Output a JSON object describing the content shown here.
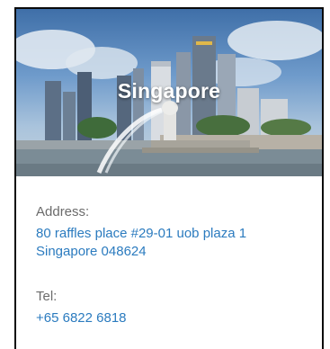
{
  "card": {
    "title": "Singapore",
    "address_label": "Address:",
    "address_line1": "80 raffles place #29-01 uob plaza 1",
    "address_line2": "Singapore 048624",
    "tel_label": "Tel:",
    "tel_value": "+65 6822 6818"
  },
  "colors": {
    "link": "#2b7bbf",
    "label": "#6b6b6b",
    "border": "#0a0a0a"
  }
}
